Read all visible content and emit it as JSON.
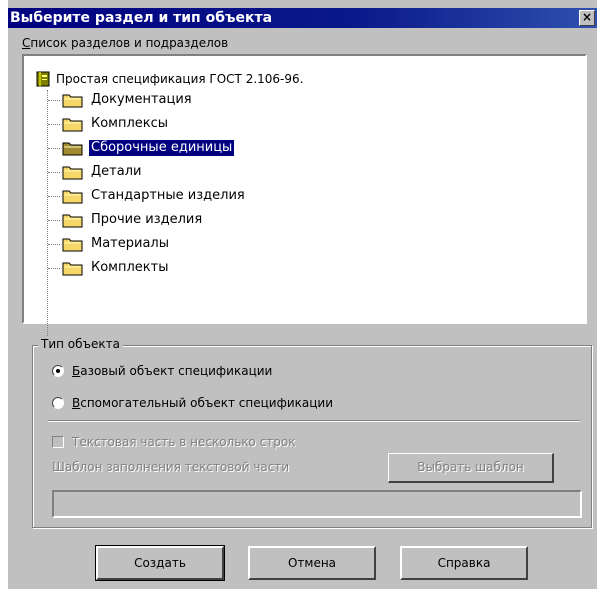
{
  "window": {
    "title": "Выберите раздел и тип объекта",
    "close_glyph": "×"
  },
  "tree": {
    "label_first": "С",
    "label_rest": "писок разделов и подразделов",
    "root": {
      "label": "Простая спецификация ГОСТ 2.106-96.",
      "icon": "book-icon"
    },
    "items": [
      {
        "label": "Документация",
        "icon": "folder-icon",
        "selected": false
      },
      {
        "label": "Комплексы",
        "icon": "folder-icon",
        "selected": false
      },
      {
        "label": "Сборочные единицы",
        "icon": "folder-open-icon",
        "selected": true
      },
      {
        "label": "Детали",
        "icon": "folder-icon",
        "selected": false
      },
      {
        "label": "Стандартные изделия",
        "icon": "folder-icon",
        "selected": false
      },
      {
        "label": "Прочие изделия",
        "icon": "folder-icon",
        "selected": false
      },
      {
        "label": "Материалы",
        "icon": "folder-icon",
        "selected": false
      },
      {
        "label": "Комплекты",
        "icon": "folder-icon",
        "selected": false
      }
    ]
  },
  "object_type": {
    "title": "Тип объекта",
    "base_first": "Б",
    "base_rest": "азовый объект спецификации",
    "base_checked": true,
    "aux_first": "В",
    "aux_rest": "спомогательный объект спецификации",
    "aux_checked": false,
    "text_part_label": "Текстовая часть в несколько строк",
    "text_part_checked": false,
    "template_label": "Шаблон заполнения текстовой части",
    "choose_template_button": "Выбрать шаблон",
    "template_value": ""
  },
  "buttons": {
    "create": "Создать",
    "cancel": "Отмена",
    "help": "Справка"
  },
  "colors": {
    "title_bar": "#000080",
    "dialog_bg": "#c0c0c0",
    "selection": "#000080",
    "folder": "#f4d86a"
  }
}
